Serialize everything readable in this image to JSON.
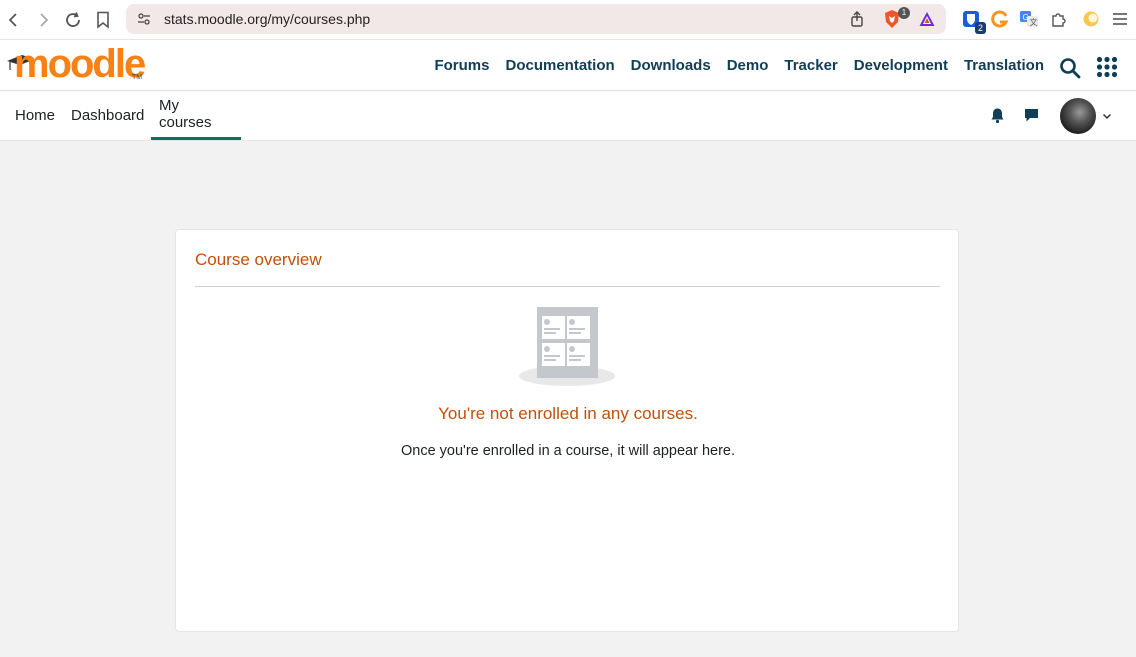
{
  "browser": {
    "url": "stats.moodle.org/my/courses.php",
    "brave_badge": "1",
    "ext_badge": "2"
  },
  "brand": {
    "logo_text": "moodle",
    "logo_tm": "TM",
    "accent": "#f98012",
    "nav_color": "#0f3e55"
  },
  "mainmenu": {
    "items": [
      "Forums",
      "Documentation",
      "Downloads",
      "Demo",
      "Tracker",
      "Development",
      "Translation"
    ]
  },
  "secnav": {
    "tabs": [
      "Home",
      "Dashboard",
      "My courses"
    ],
    "active": "My courses"
  },
  "card": {
    "title": "Course overview",
    "empty_title": "You're not enrolled in any courses.",
    "empty_subtitle": "Once you're enrolled in a course, it will appear here."
  }
}
